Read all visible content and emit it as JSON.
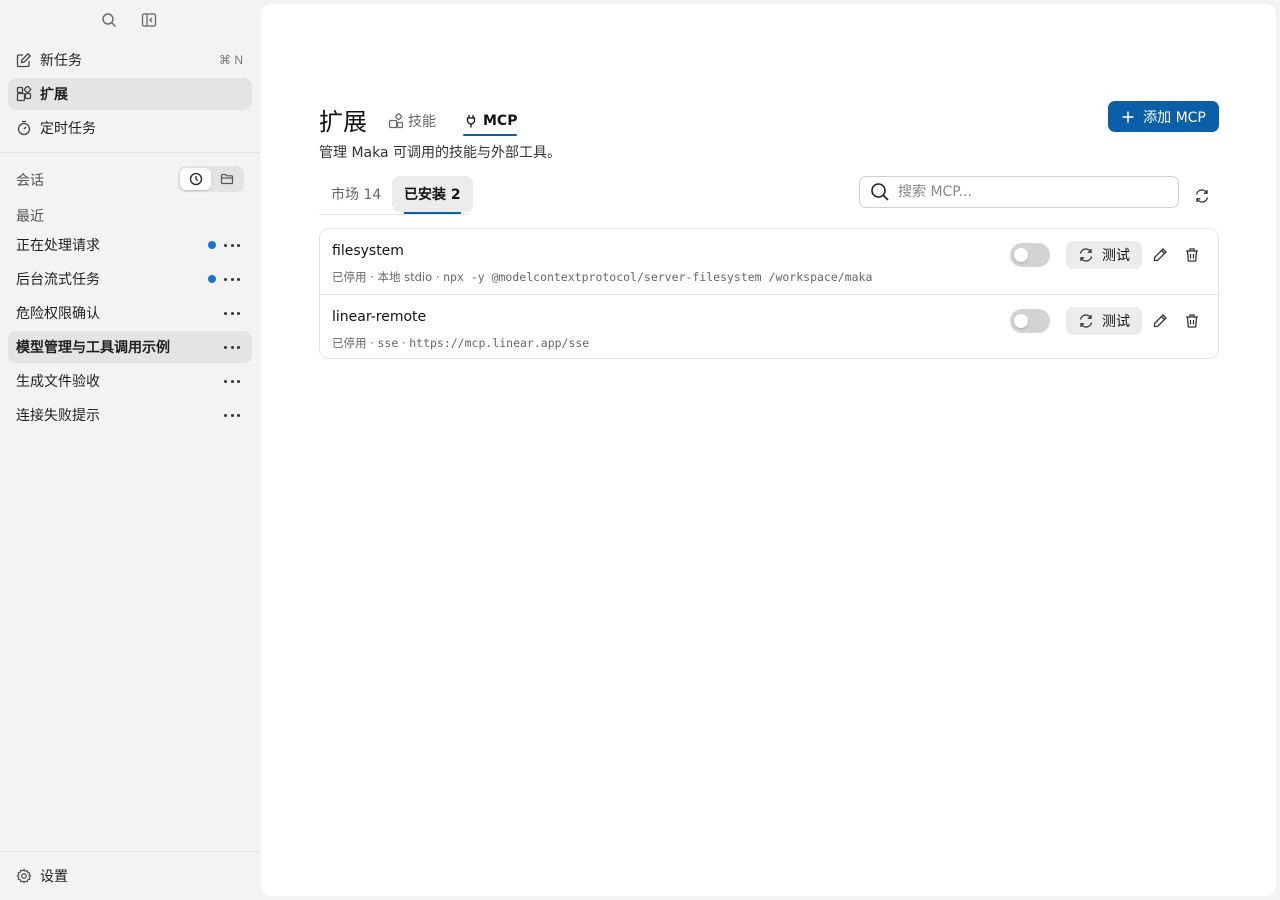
{
  "sidebar": {
    "nav": {
      "new_task": "新任务",
      "new_task_shortcut": "⌘ N",
      "extensions": "扩展",
      "scheduled": "定时任务"
    },
    "sessions_title": "会话",
    "recent_title": "最近",
    "conversations": [
      {
        "label": "正在处理请求",
        "unread": true
      },
      {
        "label": "后台流式任务",
        "unread": true
      },
      {
        "label": "危险权限确认",
        "unread": false
      },
      {
        "label": "模型管理与工具调用示例",
        "unread": false,
        "active": true
      },
      {
        "label": "生成文件验收",
        "unread": false
      },
      {
        "label": "连接失败提示",
        "unread": false
      }
    ],
    "settings": "设置"
  },
  "main": {
    "title": "扩展",
    "tabs": {
      "skills": "技能",
      "mcp": "MCP"
    },
    "subtitle": "管理 Maka 可调用的技能与外部工具。",
    "add_button": "添加 MCP",
    "segments": {
      "market": "市场 14",
      "installed": "已安装 2"
    },
    "search_placeholder": "搜索 MCP...",
    "servers": [
      {
        "name": "filesystem",
        "status": "已停用",
        "transport": "本地 stdio",
        "command": "npx -y @modelcontextprotocol/server-filesystem /workspace/maka",
        "enabled": false,
        "test_label": "测试"
      },
      {
        "name": "linear-remote",
        "status": "已停用",
        "transport": "sse",
        "command": "https://mcp.linear.app/sse",
        "enabled": false,
        "test_label": "测试"
      }
    ]
  },
  "colors": {
    "accent": "#0b5ea8",
    "unread_dot": "#1a73d9"
  }
}
